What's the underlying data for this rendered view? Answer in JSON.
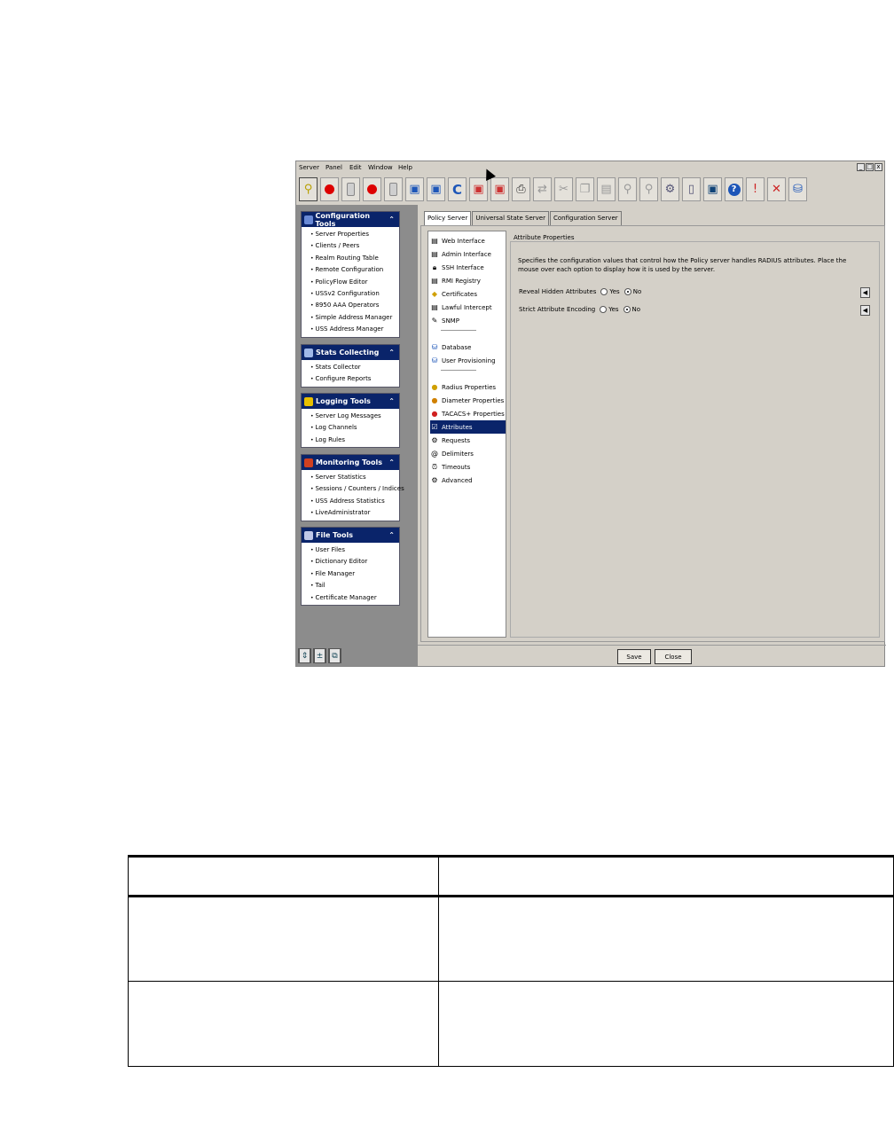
{
  "menubar": [
    "Server",
    "Panel",
    "Edit",
    "Window",
    "Help"
  ],
  "window_controls": [
    "_",
    "□",
    "x"
  ],
  "panels": [
    {
      "title": "Configuration Tools",
      "icon_color": "#6a8ad6",
      "items": [
        "Server Properties",
        "Clients / Peers",
        "Realm Routing Table",
        "Remote Configuration",
        "PolicyFlow Editor",
        "USSv2 Configuration",
        "8950 AAA Operators",
        "Simple Address Manager",
        "USS Address Manager"
      ]
    },
    {
      "title": "Stats Collecting",
      "icon_color": "#a0b8e8",
      "items": [
        "Stats Collector",
        "Configure Reports"
      ]
    },
    {
      "title": "Logging Tools",
      "icon_color": "#e8c000",
      "items": [
        "Server Log Messages",
        "Log Channels",
        "Log Rules"
      ]
    },
    {
      "title": "Monitoring Tools",
      "icon_color": "#d04020",
      "items": [
        "Server Statistics",
        "Sessions / Counters / Indices",
        "USS Address Statistics",
        "LiveAdministrator"
      ]
    },
    {
      "title": "File Tools",
      "icon_color": "#c0c8e8",
      "items": [
        "User Files",
        "Dictionary Editor",
        "File Manager",
        "Tail",
        "Certificate Manager"
      ]
    }
  ],
  "collapse_glyph": "⌃",
  "tabs": [
    "Policy Server",
    "Universal State Server",
    "Configuration Server"
  ],
  "nav_items": [
    "Web Interface",
    "Admin Interface",
    "SSH Interface",
    "RMI Registry",
    "Certificates",
    "Lawful Intercept",
    "SNMP",
    "Database",
    "User Provisioning",
    "Radius Properties",
    "Diameter Properties",
    "TACACS+ Properties",
    "Attributes",
    "Requests",
    "Delimiters",
    "Timeouts",
    "Advanced"
  ],
  "nav_selected": "Attributes",
  "attributes": {
    "legend": "Attribute Properties",
    "description": "Specifies the configuration values that control how the Policy server handles RADIUS attributes. Place the mouse over each option to display how it is used by the server.",
    "options": [
      {
        "label": "Reveal Hidden Attributes",
        "yes": "Yes",
        "no": "No",
        "value": "No"
      },
      {
        "label": "Strict Attribute Encoding",
        "yes": "Yes",
        "no": "No",
        "value": "No"
      }
    ]
  },
  "buttons": {
    "save": "Save",
    "close": "Close"
  },
  "accent_color": "#0a246a"
}
